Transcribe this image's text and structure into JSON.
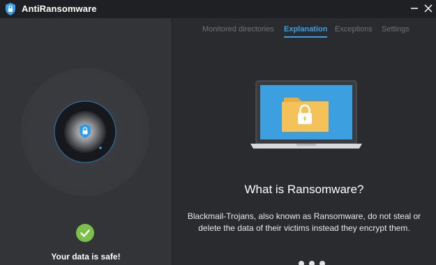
{
  "app": {
    "title": "AntiRansomware"
  },
  "tabs": [
    {
      "label": "Monitored directories",
      "active": false
    },
    {
      "label": "Explanation",
      "active": true
    },
    {
      "label": "Exceptions",
      "active": false
    },
    {
      "label": "Settings",
      "active": false
    }
  ],
  "status": {
    "text": "Your data is safe!",
    "icon": "check-icon"
  },
  "explanation": {
    "heading": "What is Ransomware?",
    "body": "Blackmail-Trojans, also known as Ransomware, do not steal or delete the data of their victims instead they encrypt them."
  },
  "colors": {
    "accent": "#3aa0e8",
    "safe_green": "#7cc04a",
    "folder": "#f5c25a",
    "screen_blue": "#3c9fe0"
  }
}
